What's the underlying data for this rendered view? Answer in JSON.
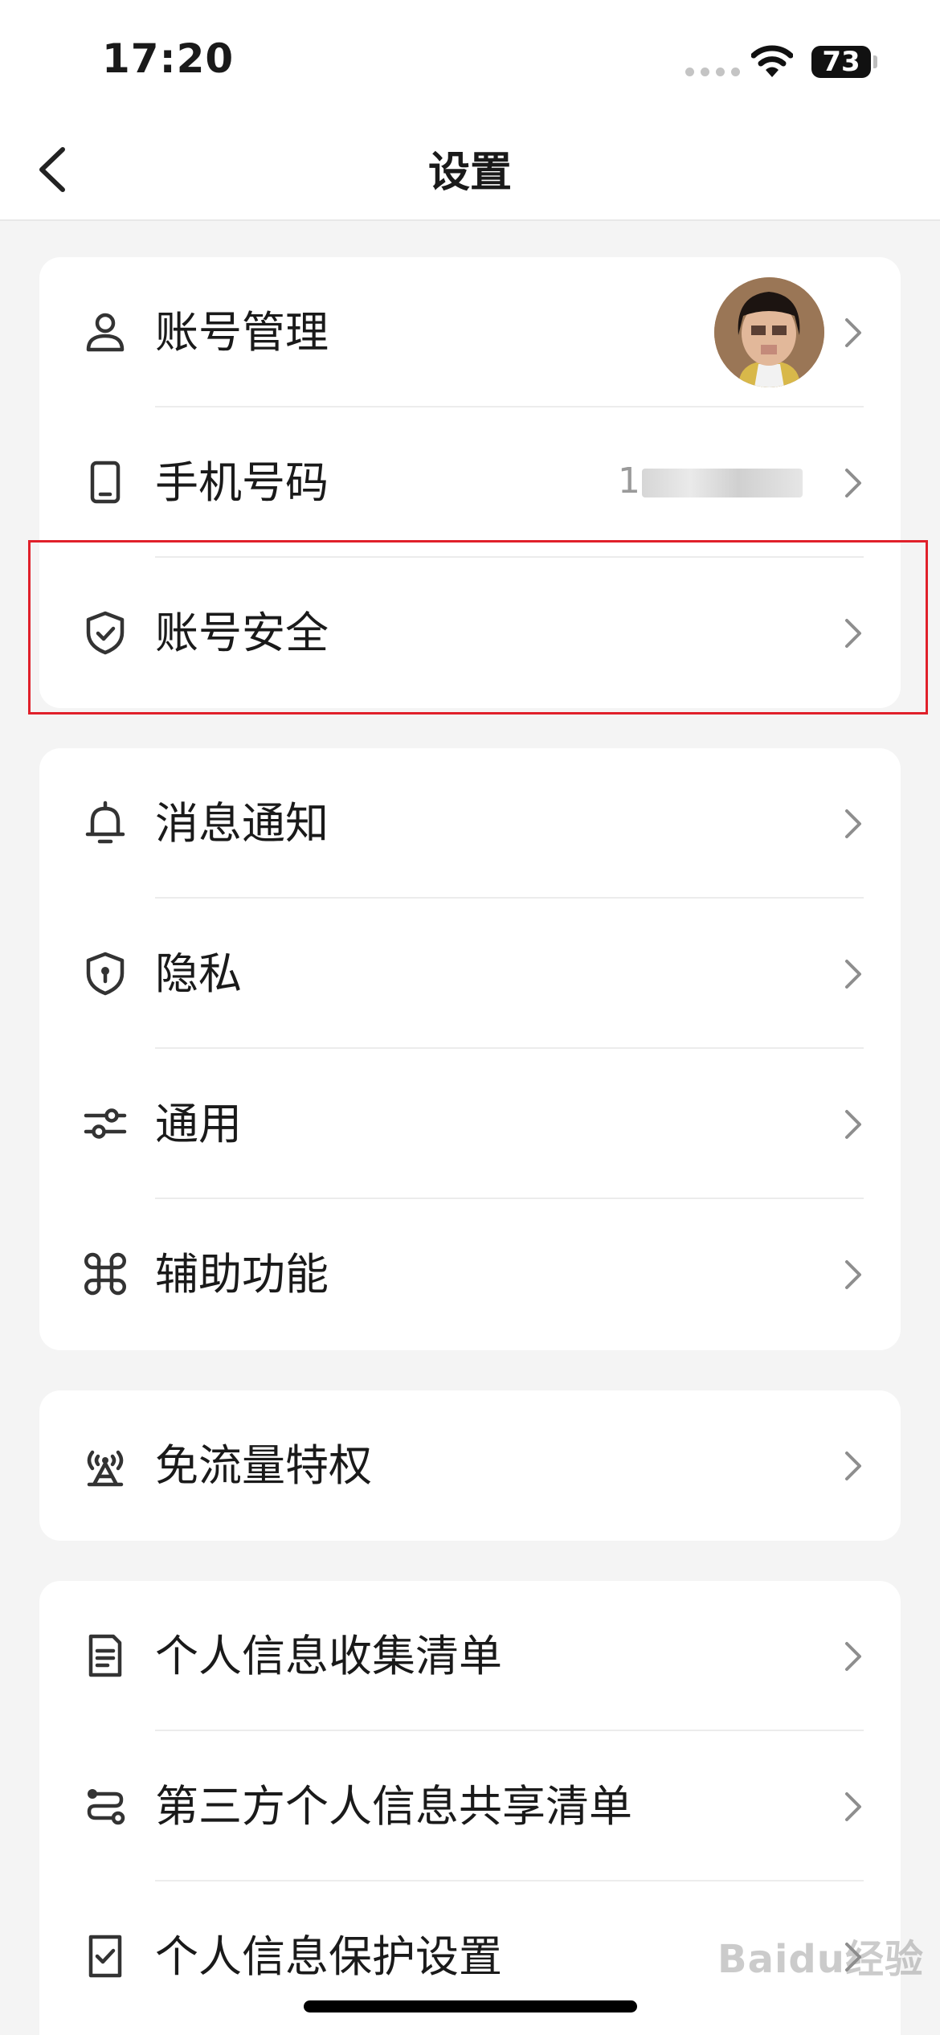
{
  "status_bar": {
    "time": "17:20",
    "battery": "73"
  },
  "nav": {
    "title": "设置"
  },
  "groups": [
    {
      "items": [
        {
          "label": "账号管理"
        },
        {
          "label": "手机号码",
          "value": "1"
        },
        {
          "label": "账号安全"
        }
      ]
    },
    {
      "items": [
        {
          "label": "消息通知"
        },
        {
          "label": "隐私"
        },
        {
          "label": "通用"
        },
        {
          "label": "辅助功能"
        }
      ]
    },
    {
      "items": [
        {
          "label": "免流量特权"
        }
      ]
    },
    {
      "items": [
        {
          "label": "个人信息收集清单"
        },
        {
          "label": "第三方个人信息共享清单"
        },
        {
          "label": "个人信息保护设置"
        }
      ]
    }
  ],
  "watermark": "Baidu经验",
  "colors": {
    "highlight": "#e0202a",
    "background": "#f4f4f4",
    "card": "#ffffff"
  }
}
